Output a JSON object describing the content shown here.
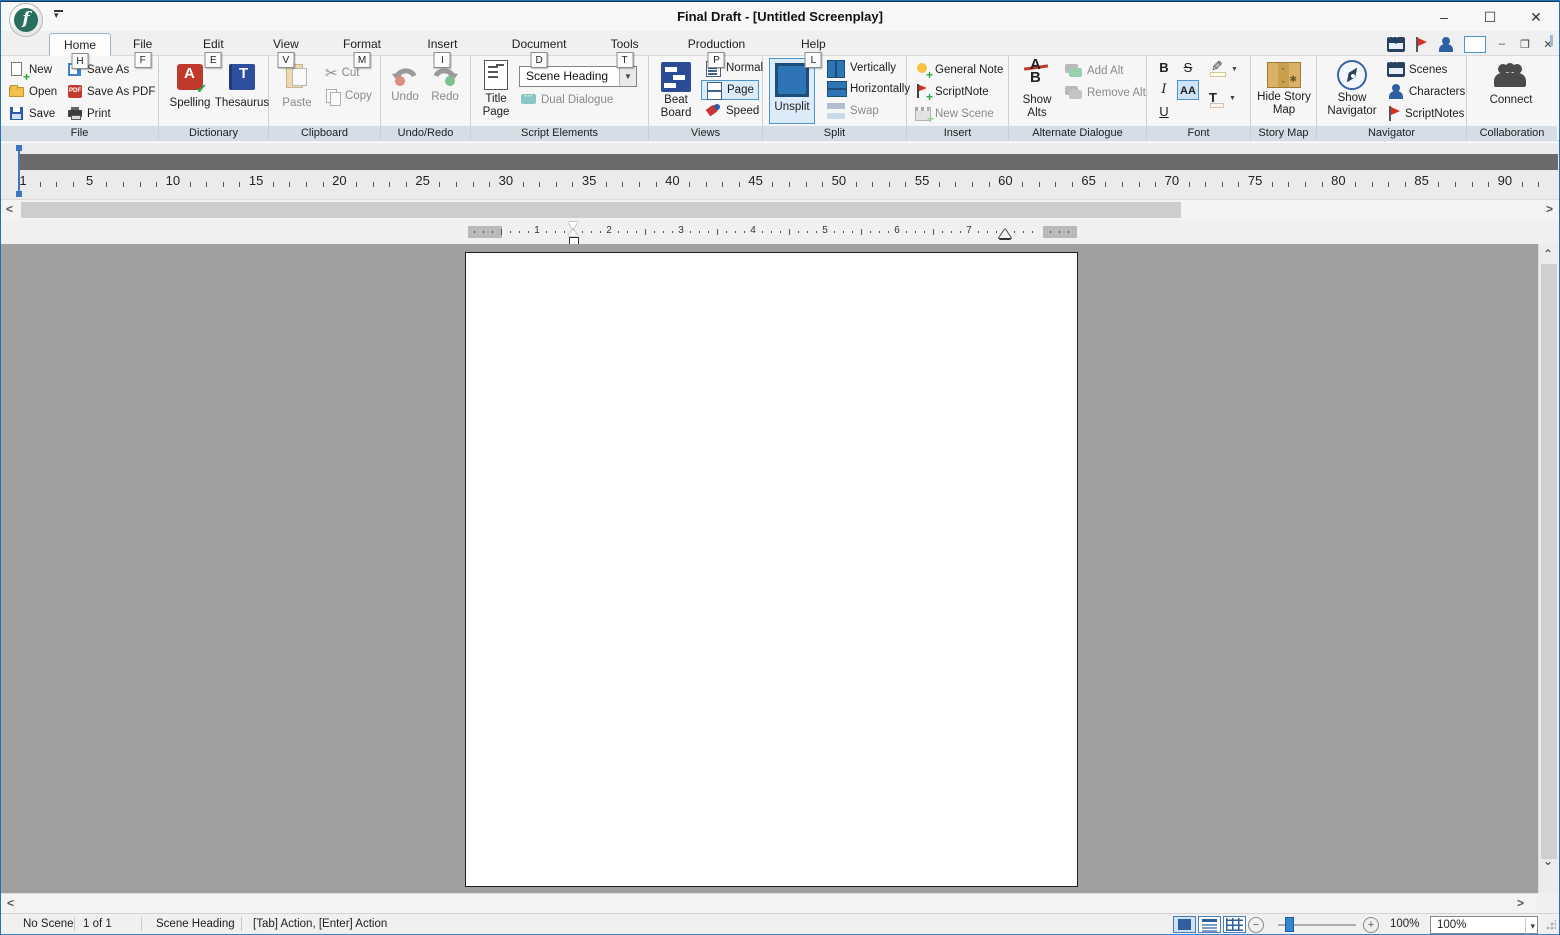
{
  "window": {
    "title": "Final Draft - [Untitled Screenplay]",
    "controls": {
      "minimize": "–",
      "maximize": "☐",
      "close": "✕"
    },
    "mdi_controls": {
      "minimize": "–",
      "restore": "❐",
      "close": "✕"
    },
    "logo_letter": "f"
  },
  "tabs": {
    "active": "Home",
    "items": [
      {
        "label": "Home",
        "keytip": "H"
      },
      {
        "label": "File",
        "keytip": "F"
      },
      {
        "label": "Edit",
        "keytip": "E"
      },
      {
        "label": "View",
        "keytip": "V"
      },
      {
        "label": "Format",
        "keytip": "M"
      },
      {
        "label": "Insert",
        "keytip": "I"
      },
      {
        "label": "Document",
        "keytip": "D"
      },
      {
        "label": "Tools",
        "keytip": "T"
      },
      {
        "label": "Production",
        "keytip": "P"
      },
      {
        "label": "Help",
        "keytip": "L"
      }
    ]
  },
  "ribbon": {
    "file": {
      "label": "File",
      "new": "New",
      "open": "Open",
      "save": "Save",
      "save_as": "Save As",
      "save_as_pdf": "Save As PDF",
      "print": "Print"
    },
    "dictionary": {
      "label": "Dictionary",
      "spelling": "Spelling",
      "thesaurus": "Thesaurus"
    },
    "clipboard": {
      "label": "Clipboard",
      "paste": "Paste",
      "cut": "Cut",
      "copy": "Copy"
    },
    "undo_redo": {
      "label": "Undo/Redo",
      "undo": "Undo",
      "redo": "Redo"
    },
    "script_elements": {
      "label": "Script Elements",
      "title_page": "Title Page",
      "element_selected": "Scene Heading",
      "dual_dialogue": "Dual Dialogue"
    },
    "views": {
      "label": "Views",
      "beat_board": "Beat Board",
      "normal": "Normal",
      "page": "Page",
      "speed": "Speed",
      "active_view": "Page"
    },
    "split": {
      "label": "Split",
      "unsplit": "Unsplit",
      "vertically": "Vertically",
      "horizontally": "Horizontally",
      "swap": "Swap",
      "active": "Unsplit"
    },
    "insert": {
      "label": "Insert",
      "general_note": "General Note",
      "scriptnote": "ScriptNote",
      "new_scene": "New Scene"
    },
    "alt_dialogue": {
      "label": "Alternate Dialogue",
      "show_alts": "Show Alts",
      "add_alt": "Add Alt",
      "remove_alt": "Remove Alt"
    },
    "font": {
      "label": "Font",
      "bold": "B",
      "strikethrough": "S",
      "italic": "I",
      "caps": "AA",
      "underline": "U",
      "text_color": "T"
    },
    "story_map": {
      "label": "Story Map",
      "hide": "Hide Story Map"
    },
    "navigator": {
      "label": "Navigator",
      "show": "Show Navigator",
      "scenes": "Scenes",
      "characters": "Characters",
      "scriptnotes": "ScriptNotes"
    },
    "collaboration": {
      "label": "Collaboration",
      "connect": "Connect"
    }
  },
  "ruler_main": {
    "unit_start": 1,
    "unit_end": 92,
    "numbered_every": 5,
    "numbers": [
      1,
      5,
      10,
      15,
      20,
      25,
      30,
      35,
      40,
      45,
      50,
      55,
      60,
      65,
      70,
      75,
      80,
      85,
      90
    ]
  },
  "ruler_page": {
    "inch_numbers": [
      1,
      2,
      3,
      4,
      5,
      6,
      7
    ],
    "indent_marker_inch": 1.5,
    "right_margin_marker_inch": 7.5
  },
  "statusbar": {
    "scene": "No Scene",
    "page": "1 of 1",
    "element": "Scene Heading",
    "hint": "[Tab]  Action,  [Enter] Action",
    "zoom_out": "−",
    "zoom_in": "+",
    "zoom_percent": "100%",
    "zoom_select_value": "100%"
  },
  "colors": {
    "accent_blue": "#2f75b5",
    "selection_fill": "#cfe3f7",
    "selection_border": "#4f94cd",
    "group_label_bg": "#d5dde6",
    "ruler_bar": "#6a6a6a",
    "doc_background": "#a0a0a0",
    "flag_red": "#d93025",
    "plus_green": "#27a844",
    "window_bottom_border": "#2f86d2"
  }
}
